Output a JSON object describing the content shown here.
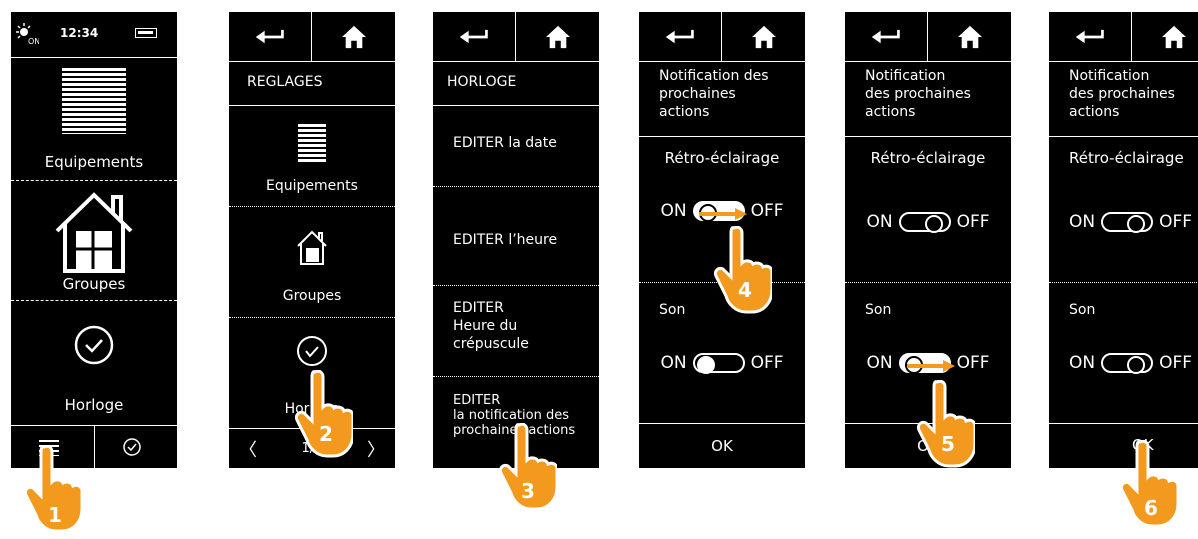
{
  "screen1": {
    "time": "12:34",
    "items": [
      {
        "label": "Equipements"
      },
      {
        "label": "Groupes"
      },
      {
        "label": "Horloge"
      }
    ]
  },
  "screen2": {
    "title": "REGLAGES",
    "items": [
      {
        "label": "Equipements"
      },
      {
        "label": "Groupes"
      },
      {
        "label": "Horloge"
      }
    ],
    "page": "1/2"
  },
  "screen3": {
    "title": "HORLOGE",
    "items": [
      {
        "label": "EDITER la date"
      },
      {
        "label": "EDITER l’heure"
      },
      {
        "label": "EDITER\nHeure du\ncrépuscule"
      },
      {
        "label": "EDITER\nla notification des\nprochaines actions"
      }
    ]
  },
  "screen4": {
    "title": "Notification des\nprochaines\nactions",
    "backlight": "Rétro-éclairage",
    "sound": "Son",
    "on": "ON",
    "off": "OFF",
    "ok": "OK"
  },
  "screen5": {
    "title": "Notification\ndes prochaines\nactions",
    "backlight": "Rétro-éclairage",
    "sound": "Son",
    "on": "ON",
    "off": "OFF",
    "ok": "OK"
  },
  "screen6": {
    "title": "Notification\ndes prochaines\nactions",
    "backlight": "Rétro-éclairage",
    "sound": "Son",
    "on": "ON",
    "off": "OFF",
    "ok": "OK"
  },
  "steps": [
    "1",
    "2",
    "3",
    "4",
    "5",
    "6"
  ],
  "colors": {
    "hand": "#f39a1e",
    "arrow": "#f39a1e",
    "screen": "#000000"
  }
}
